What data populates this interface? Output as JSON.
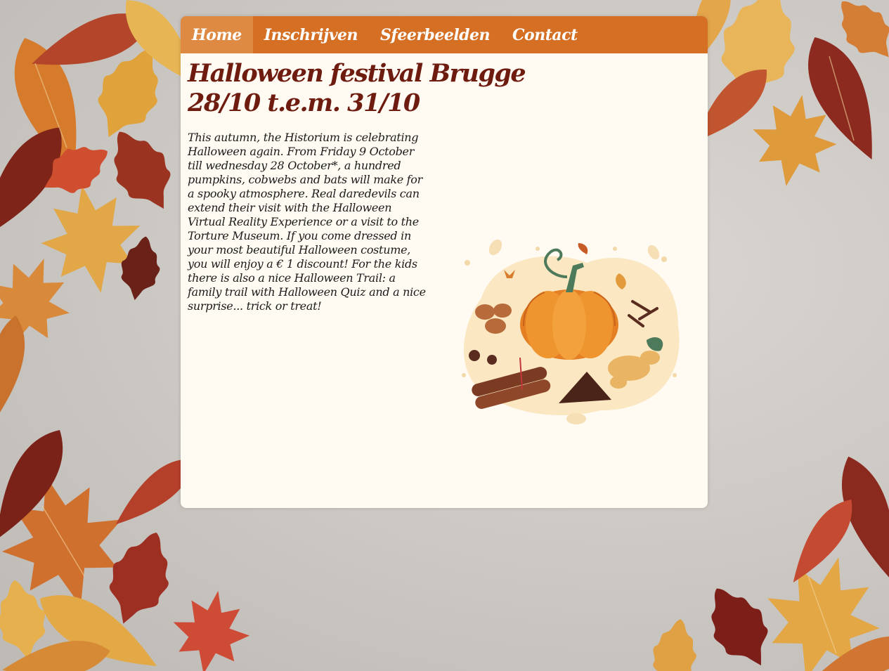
{
  "nav": {
    "items": [
      {
        "label": "Home",
        "active": true
      },
      {
        "label": "Inschrijven",
        "active": false
      },
      {
        "label": "Sfeerbeelden",
        "active": false
      },
      {
        "label": "Contact",
        "active": false
      }
    ]
  },
  "page": {
    "title_line1": "Halloween festival Brugge",
    "title_line2": "28/10 t.e.m. 31/10",
    "body": "This autumn, the Historium is celebrating Halloween again. From Friday 9 October till wednesday 28 October*, a hundred pumpkins, cobwebs and bats will make for a spooky atmosphere. Real daredevils can extend their visit with the Halloween Virtual Reality Experience or a visit to the Torture Museum. If you come dressed in your most beautiful Halloween costume, you will enjoy a € 1 discount! For the kids there is also a nice Halloween Trail: a family trail with Halloween Quiz and a nice surprise... trick or treat!"
  },
  "colors": {
    "nav_bg": "#d56f24",
    "nav_active_bg": "#df8a43",
    "card_bg": "#fffbf2",
    "title": "#6e1b10"
  },
  "icons": {
    "illustration": "pumpkin-spices-illustration"
  }
}
